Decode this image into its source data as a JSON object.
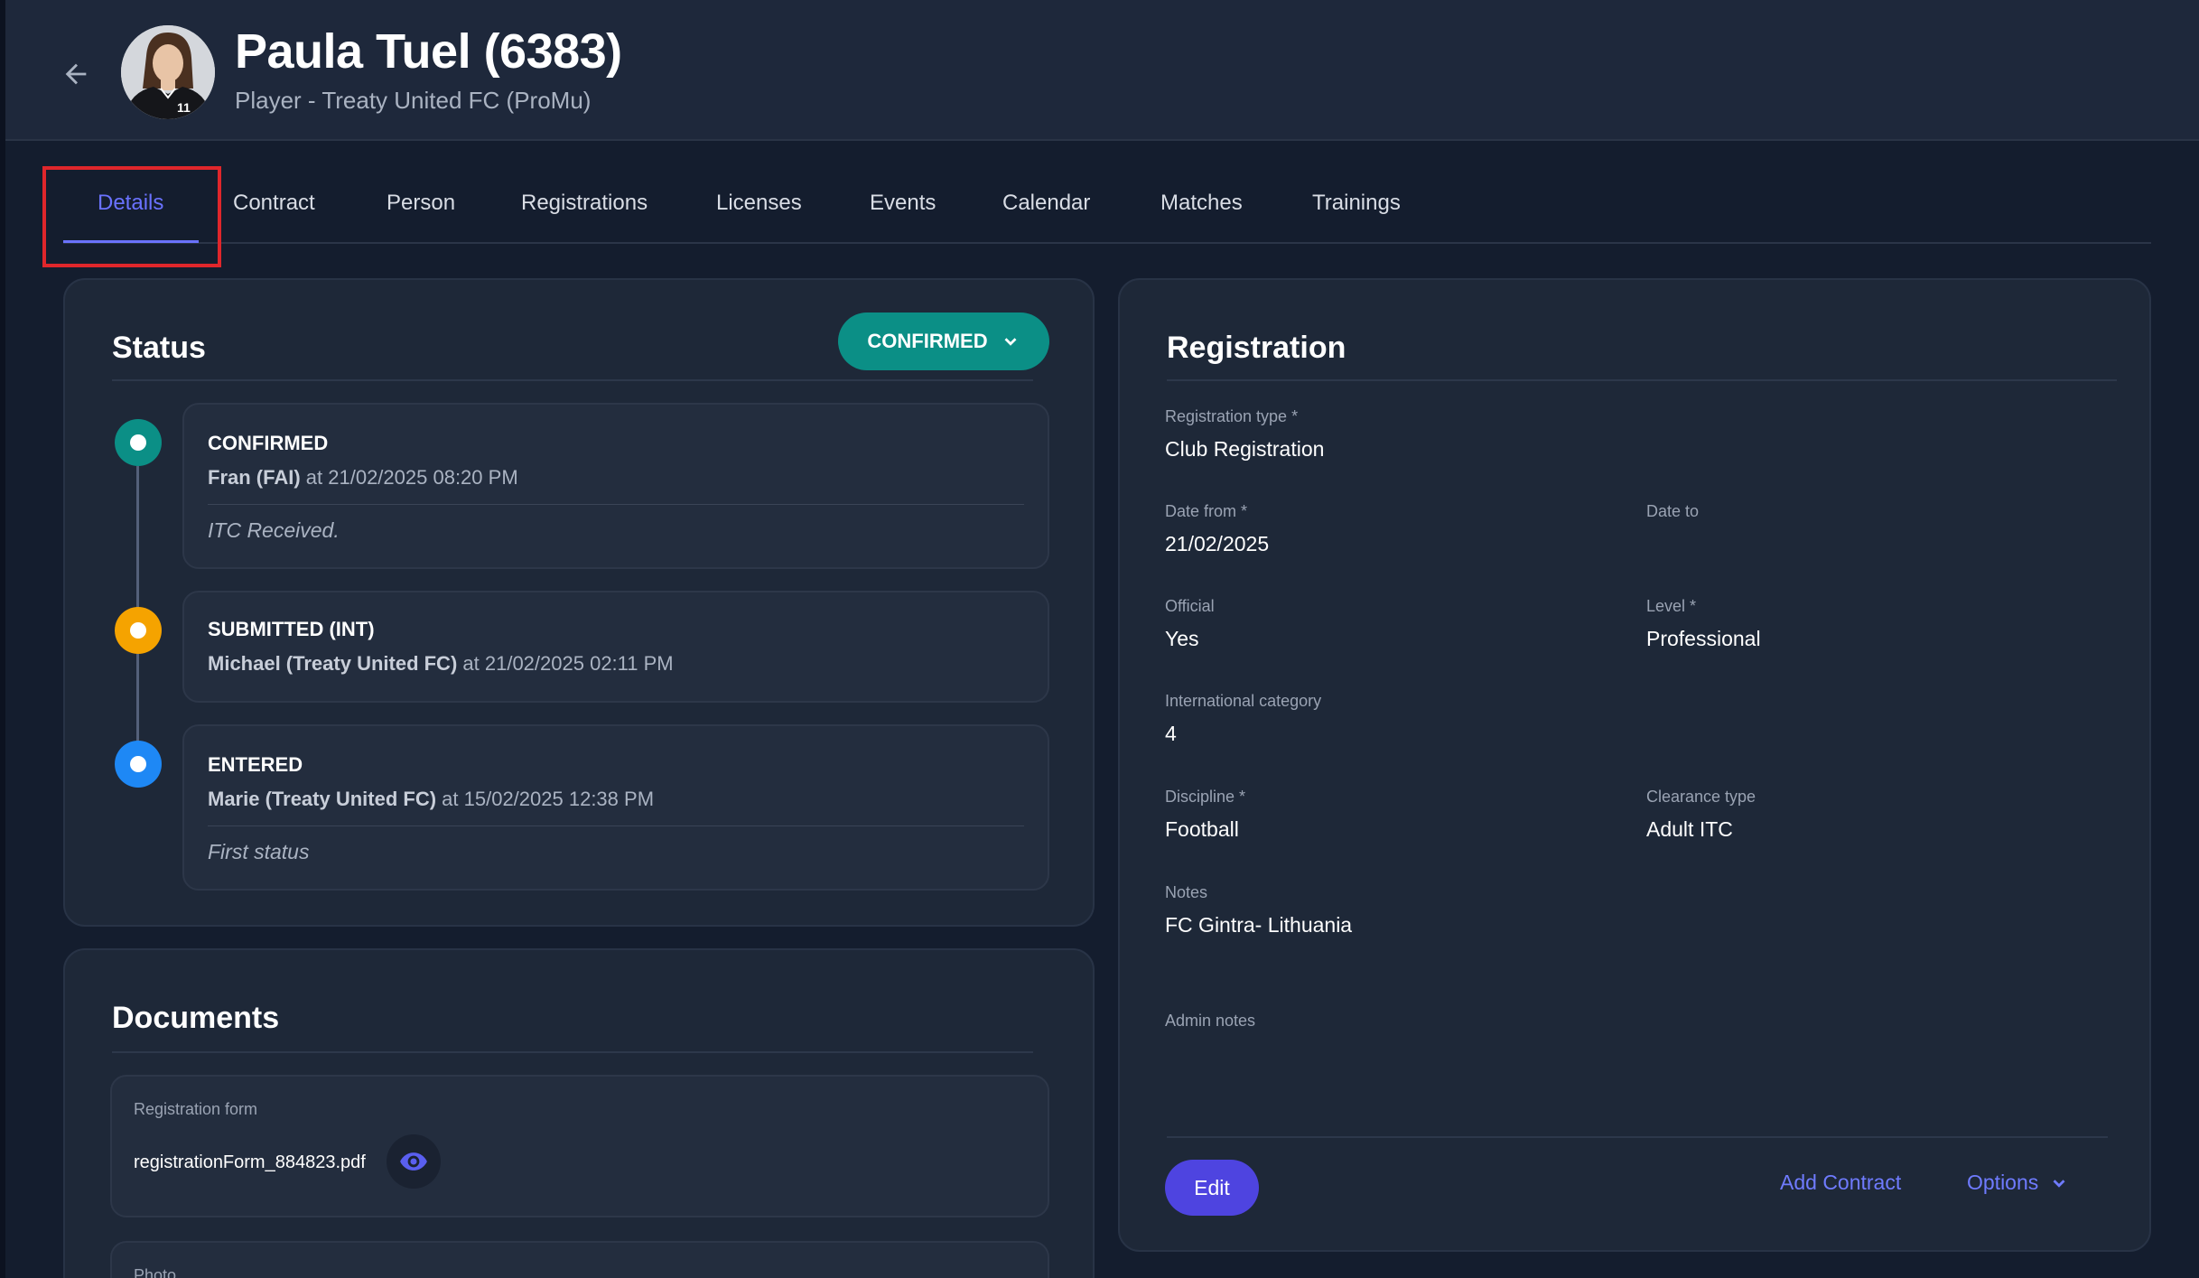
{
  "header": {
    "title": "Paula Tuel (6383)",
    "subtitle": "Player - Treaty United FC (ProMu)",
    "avatar_icon": "player-photo"
  },
  "tabs": [
    {
      "label": "Details",
      "active": true
    },
    {
      "label": "Contract"
    },
    {
      "label": "Person"
    },
    {
      "label": "Registrations"
    },
    {
      "label": "Licenses"
    },
    {
      "label": "Events"
    },
    {
      "label": "Calendar"
    },
    {
      "label": "Matches"
    },
    {
      "label": "Trainings"
    }
  ],
  "status": {
    "title": "Status",
    "current": "CONFIRMED",
    "events": [
      {
        "status": "CONFIRMED",
        "actor": "Fran (FAI)",
        "time": "at 21/02/2025 08:20 PM",
        "note": "ITC Received.",
        "color": "#0b8f86"
      },
      {
        "status": "SUBMITTED (INT)",
        "actor": "Michael (Treaty United FC)",
        "time": "at 21/02/2025 02:11 PM",
        "note": "",
        "color": "#f5a300"
      },
      {
        "status": "ENTERED",
        "actor": "Marie (Treaty United FC)",
        "time": "at 15/02/2025 12:38 PM",
        "note": "First status",
        "color": "#1e88f5"
      }
    ]
  },
  "documents": {
    "title": "Documents",
    "items": [
      {
        "label": "Registration form",
        "file": "registrationForm_884823.pdf"
      },
      {
        "label": "Photo",
        "file": ""
      }
    ]
  },
  "registration": {
    "title": "Registration",
    "fields": {
      "registration_type": {
        "label": "Registration type *",
        "value": "Club Registration"
      },
      "date_from": {
        "label": "Date from *",
        "value": "21/02/2025"
      },
      "date_to": {
        "label": "Date to",
        "value": ""
      },
      "official": {
        "label": "Official",
        "value": "Yes"
      },
      "level": {
        "label": "Level *",
        "value": "Professional"
      },
      "international_category": {
        "label": "International category",
        "value": "4"
      },
      "discipline": {
        "label": "Discipline *",
        "value": "Football"
      },
      "clearance_type": {
        "label": "Clearance type",
        "value": "Adult ITC"
      },
      "notes": {
        "label": "Notes",
        "value": "FC Gintra- Lithuania"
      },
      "admin_notes": {
        "label": "Admin notes",
        "value": ""
      }
    },
    "actions": {
      "edit": "Edit",
      "add_contract": "Add Contract",
      "options": "Options"
    }
  },
  "colors": {
    "accent": "#6a72ff",
    "confirmed": "#0b8f86",
    "highlight": "#e0262b"
  }
}
